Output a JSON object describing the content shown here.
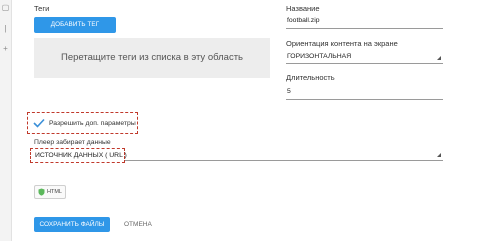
{
  "rail": {
    "icons": [
      "page-icon",
      "list-icon",
      "add-icon"
    ],
    "glyphs": [
      "▢",
      "|",
      "+"
    ]
  },
  "tags": {
    "label": "Теги",
    "add_button": "ДОБАВИТЬ ТЕГ",
    "drop_hint": "Перетащите теги из списка в эту область"
  },
  "name": {
    "label": "Название",
    "value": "football.zip"
  },
  "orientation": {
    "label": "Ориентация контента на экране",
    "value": "ГОРИЗОНТАЛЬНАЯ"
  },
  "duration": {
    "label": "Длительность",
    "value": "5"
  },
  "allow_params": {
    "label": "Разрешить доп. параметры",
    "checked": true
  },
  "data_source": {
    "label": "Плеер забирает данные",
    "value": "ИСТОЧНИК ДАННЫХ ( URL )"
  },
  "html_button": {
    "label": "HTML",
    "icon": "shield-icon"
  },
  "actions": {
    "save": "СОХРАНИТЬ ФАЙЛЫ",
    "cancel": "ОТМЕНА"
  },
  "colors": {
    "accent": "#2f97e8",
    "highlight": "#c0392b",
    "check": "#3a8fd8",
    "html_icon": "#5cb85c"
  }
}
